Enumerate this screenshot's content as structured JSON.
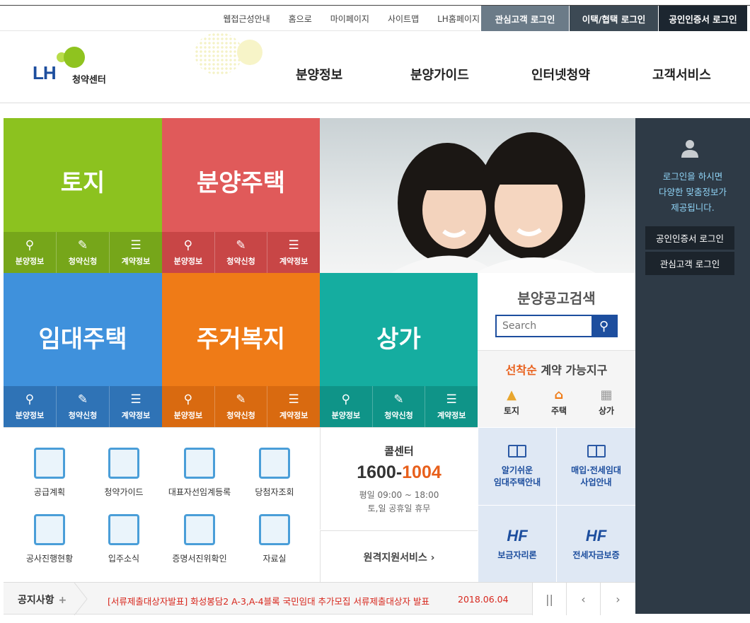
{
  "topbar": {
    "links": [
      "웹접근성안내",
      "홈으로",
      "마이페이지",
      "사이트맵",
      "LH홈페이지"
    ],
    "login_interest": "관심고객 로그인",
    "login_relocation": "이택/협택 로그인",
    "login_cert": "공인인증서 로그인"
  },
  "header": {
    "logo_text": "LH",
    "logo_sub": "청약센터",
    "nav": [
      "분양정보",
      "분양가이드",
      "인터넷청약",
      "고객서비스"
    ]
  },
  "tiles": {
    "land": {
      "title": "토지",
      "color": "#8cc21f",
      "row_color": "#76a61a",
      "actions": [
        "분양정보",
        "청약신청",
        "계약정보"
      ]
    },
    "sale_housing": {
      "title": "분양주택",
      "color": "#e05a5a",
      "row_color": "#c84646",
      "actions": [
        "분양정보",
        "청약신청",
        "계약정보"
      ]
    },
    "rental_housing": {
      "title": "임대주택",
      "color": "#3f91dc",
      "row_color": "#2f73b6",
      "actions": [
        "분양정보",
        "청약신청",
        "계약정보"
      ]
    },
    "welfare": {
      "title": "주거복지",
      "color": "#ef7b17",
      "row_color": "#d96a10",
      "actions": [
        "분양정보",
        "청약신청",
        "계약정보"
      ]
    },
    "commercial": {
      "title": "상가",
      "color": "#15ada0",
      "row_color": "#0f9488",
      "actions": [
        "분양정보",
        "청약신청",
        "계약정보"
      ]
    }
  },
  "action_icons": [
    "search-icon",
    "pen-icon",
    "checklist-icon"
  ],
  "search": {
    "title": "분양공고검색",
    "placeholder": "Search"
  },
  "first_come": {
    "highlight": "선착순",
    "rest": " 계약 가능지구",
    "items": [
      "토지",
      "주택",
      "상가"
    ]
  },
  "services": [
    "공급계획",
    "청약가이드",
    "대표자선임계등록",
    "당첨자조회",
    "공사진행현황",
    "입주소식",
    "증명서진위확인",
    "자료실"
  ],
  "call_center": {
    "title": "콜센터",
    "num_a": "1600-",
    "num_b": "1004",
    "hours": "평일 09:00 ~ 18:00",
    "holiday": "토,일 공휴일 휴무"
  },
  "remote": "원격지원서비스  ›",
  "blue_links": {
    "easy_rent": "알기쉬운\n임대주택안내",
    "purchase": "매입·전세임대\n사업안내",
    "loan": "보금자리론",
    "deposit": "전세자금보증",
    "hf": "HF"
  },
  "notice": {
    "label": "공지사항",
    "plus": "+",
    "message": "[서류제출대상자발표] 화성봉담2 A-3,A-4블록 국민임대 추가모집 서류제출대상자 발표",
    "date": "2018.06.04",
    "pause": "||",
    "prev": "‹",
    "next": "›"
  },
  "side": {
    "message_1": "로그인을 하시면",
    "message_2": "다양한 맞춤정보가",
    "message_3": "제공됩니다.",
    "cert_login": "공인인증서 로그인",
    "interest_login": "관심고객 로그인"
  }
}
